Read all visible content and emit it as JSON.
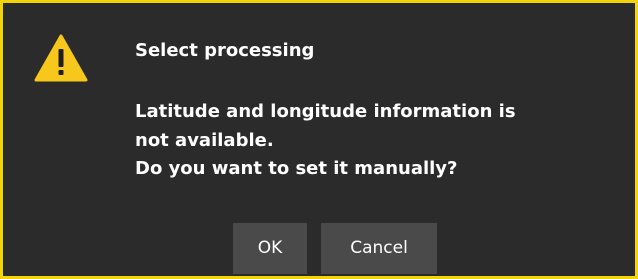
{
  "dialog": {
    "icon": "warning-triangle-icon",
    "title": "Select processing",
    "message_lines": [
      "Latitude and longitude information is",
      "not available.",
      "Do you want to set it manually?"
    ],
    "buttons": {
      "ok_label": "OK",
      "cancel_label": "Cancel"
    }
  },
  "colors": {
    "dialog_background": "#2b2b2b",
    "dialog_border": "#f2d40a",
    "button_background": "#4a4a4a",
    "text": "#ffffff",
    "icon_fill": "#f7c81b"
  }
}
